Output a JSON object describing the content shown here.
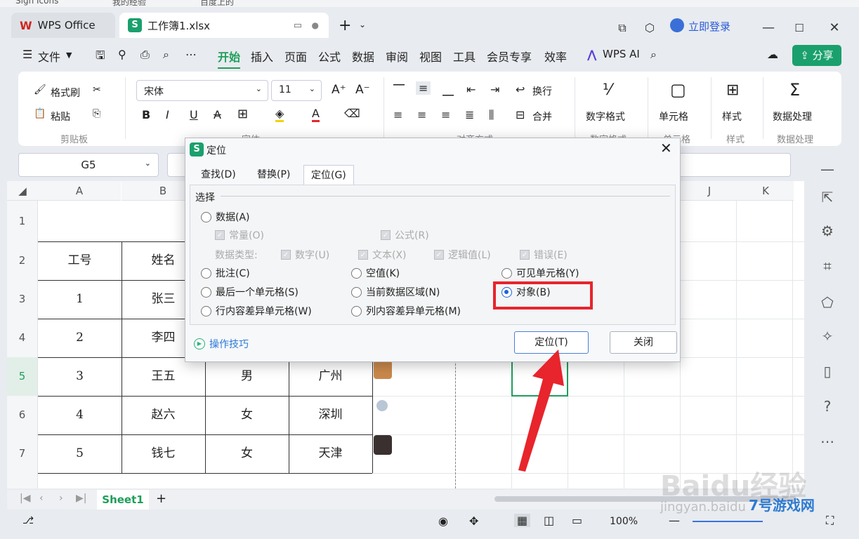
{
  "bookmarks": [
    "Sign Icons",
    "我的经验",
    "百度上的"
  ],
  "tabs": {
    "wps_label": "WPS Office",
    "doc_label": "工作簿1.xlsx",
    "new_tab": "+"
  },
  "account": {
    "login": "立即登录"
  },
  "menu": {
    "file": "文件",
    "items": [
      "开始",
      "插入",
      "页面",
      "公式",
      "数据",
      "审阅",
      "视图",
      "工具",
      "会员专享",
      "效率"
    ],
    "wps_ai": "WPS AI",
    "share": "分享"
  },
  "ribbon": {
    "format_painter": "格式刷",
    "paste": "粘贴",
    "clipboard": "剪贴板",
    "font_name": "宋体",
    "font_size": "11",
    "font_group": "字体",
    "wrap": "换行",
    "merge": "合并",
    "align_group": "对齐方式",
    "num_format": "数字格式",
    "num_group": "数字格式",
    "cell": "单元格",
    "cell_group": "单元格",
    "style": "样式",
    "style_group": "样式",
    "data_proc": "数据处理",
    "data_group": "数据处理"
  },
  "namebox": "G5",
  "columns": [
    "A",
    "B",
    "J",
    "K"
  ],
  "rows": [
    "1",
    "2",
    "3",
    "4",
    "5",
    "6",
    "7"
  ],
  "table": {
    "headers": [
      "工号",
      "姓名"
    ],
    "rows": [
      [
        "1",
        "张三",
        "",
        ""
      ],
      [
        "2",
        "李四",
        "",
        ""
      ],
      [
        "3",
        "王五",
        "男",
        "广州"
      ],
      [
        "4",
        "赵六",
        "女",
        "深圳"
      ],
      [
        "5",
        "钱七",
        "女",
        "天津"
      ]
    ]
  },
  "sheet": {
    "name": "Sheet1",
    "add": "+"
  },
  "status": {
    "zoom": "100%"
  },
  "dialog": {
    "title": "定位",
    "tabs": [
      "查找(D)",
      "替换(P)",
      "定位(G)"
    ],
    "section": "选择",
    "data": "数据(A)",
    "constant": "常量(O)",
    "formula": "公式(R)",
    "data_type": "数据类型:",
    "number": "数字(U)",
    "text": "文本(X)",
    "logical": "逻辑值(L)",
    "error": "错误(E)",
    "comment": "批注(C)",
    "blank": "空值(K)",
    "visible": "可见单元格(Y)",
    "last_cell": "最后一个单元格(S)",
    "current_region": "当前数据区域(N)",
    "objects": "对象(B)",
    "row_diff": "行内容差异单元格(W)",
    "col_diff": "列内容差异单元格(M)",
    "tips": "操作技巧",
    "ok": "定位(T)",
    "close": "关闭"
  },
  "watermark": {
    "text1": "Baidu经验",
    "text2": "jingyan.baidu",
    "text3": "7号游戏网"
  },
  "colors": {
    "accent": "#1e9e5a",
    "highlight": "#e8242c",
    "radio": "#1e63d6"
  }
}
